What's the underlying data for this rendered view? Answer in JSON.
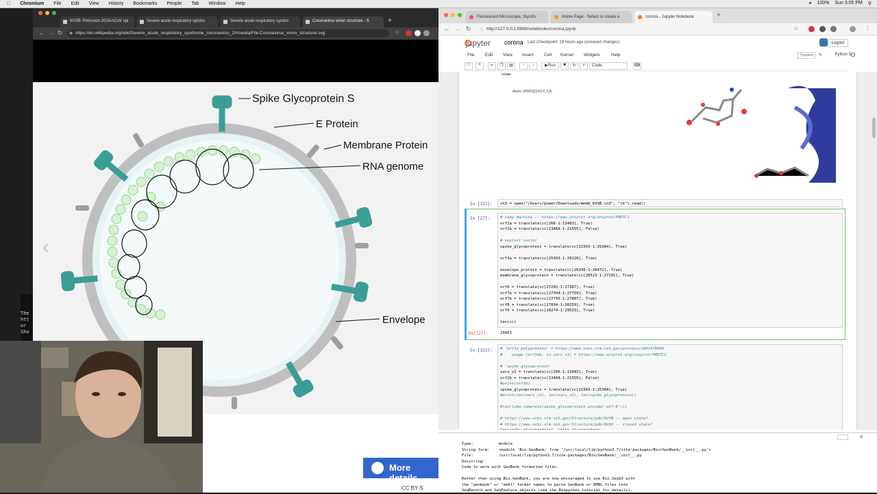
{
  "menubar": {
    "app": "Chromium",
    "items": [
      "File",
      "Edit",
      "View",
      "History",
      "Bookmarks",
      "People",
      "Tab",
      "Window",
      "Help"
    ],
    "battery": "100%",
    "clock": "Sun 3:05 PM"
  },
  "left_browser": {
    "tabs": [
      {
        "label": "6VSB: Prefusion 2019-nCoV spi"
      },
      {
        "label": "Severe acute respiratory syndro"
      },
      {
        "label": "Severe acute respiratory syndro"
      },
      {
        "label": "Coronavirus virion structure - S"
      }
    ],
    "url": "https://en.wikipedia.org/wiki/Severe_acute_respiratory_syndrome_coronavirus_2#/media/File:Coronavirus_virion_structure.svg",
    "diagram_labels": {
      "spike": "Spike Glycoprotein S",
      "e_protein": "E Protein",
      "membrane": "Membrane Protein",
      "rna": "RNA genome",
      "envelope": "Envelope"
    },
    "more_details": "More details",
    "license": "CC BY-S"
  },
  "terminal_strip": [
    "The",
    "htt",
    " or",
    "Shu"
  ],
  "right_browser": {
    "tabs": [
      {
        "label": "Fluorescent Microscope, Styrofo"
      },
      {
        "label": "Home Page - Select or create a"
      },
      {
        "label": "corona - Jupyter Notebook"
      }
    ],
    "url": "http://127.0.0.1:8889/notebooks/corona.ipynb"
  },
  "jupyter": {
    "logo": "jupyter",
    "notebook_name": "corona",
    "checkpoint": "Last Checkpoint: 19 hours ago  (unsaved changes)",
    "logout": "Logout",
    "menu": [
      "File",
      "Edit",
      "View",
      "Insert",
      "Cell",
      "Kernel",
      "Widgets",
      "Help"
    ],
    "trusted": "Trusted",
    "kernel": "Python 3",
    "run_label": "Run",
    "cell_type": "Code",
    "view_text": "view",
    "atom_text": "Atom: [PRO]1143:C.CA",
    "cells": [
      {
        "prompt": "In [137]:",
        "code": "cn3 = open(\"/Users/power/Downloads/mmdb_6VSB.cn3\", \"rb\").read()"
      },
      {
        "prompt": "In [27]:",
        "lines": [
          "# copy machine -- https://www.uniprot.org/uniprot/P0DTC1",
          "orf1a = translate(cc[266-1:13483], True)",
          "orf1b = translate(cc[13468-1:21555], False)",
          "",
          "# exploit vector",
          "spike_glycoprotein = translate(cc[21563-1:25384], True)",
          "",
          "orf3a = translate(cc[25393-1:26220], True)",
          "",
          "envelope_protein = translate(cc[26245-1:26472], True)",
          "membrane_glycoprotein = translate(cc[26523-1:27191], True)",
          "",
          "orf6 = translate(cc[27202-1:27387], True)",
          "orf7a = translate(cc[27394-1:27759], True)",
          "orf7b = translate(cc[27756-1:27887], True)",
          "orf8 = translate(cc[27894-1:28259], True)",
          "orf9 = translate(cc[28274-1:29533], True)",
          "",
          "len(cc)"
        ],
        "out_prompt": "Out[27]:",
        "output": "29903"
      },
      {
        "prompt": "In [133]:",
        "lines": [
          "# 'orf1a polyprotein' = https://www.ncbi.nlm.nih.gov/protein/1802476803",
          "#    usage (orf1ab, in sars_v1) = https://www.uniprot.org/uniprot/P0DTC1",
          "",
          "# 'spike glycoprotein'",
          "sars_v2 = translate(cc[266-1:13483], True)",
          "orf1b = translate(cc[13468-1:21555], False)",
          "#print(orf1b)",
          "spike_glycoprotein = translate(cc[21563-1:25384], True)",
          "#print(len(sars_v1), len(sars_v2), len(spike_glycoprotein))",
          "",
          "#len(lzma.compress(spike_glycoprotein.encode('utf-8')))",
          "",
          "# https://www.ncbi.nlm.nih.gov/Structure/pdb/6VYB -- open state?",
          "# https://www.ncbi.nlm.nih.gov/Structure/pdb/6VXX -- closed state?",
          "len(spike_glycoprotein), spike_glycoprotein"
        ]
      }
    ],
    "pager": [
      "Type:           module",
      "String form:    <module 'Bio.GenBank' from '/usr/local/lib/python3.7/site-packages/Bio/GenBank/__init__.py'>",
      "File:           /usr/local/lib/python3.7/site-packages/Bio/GenBank/__init__.py",
      "Docstring:",
      "Code to work with GenBank formatted files.",
      "",
      "Rather than using Bio.GenBank, you are now encouraged to use Bio.SeqIO with",
      "the \"genbank\" or \"embl\" format names to parse GenBank or EMBL files into",
      "SeqRecord and SeqFeature objects (see the Biopython tutorial for details)."
    ]
  }
}
